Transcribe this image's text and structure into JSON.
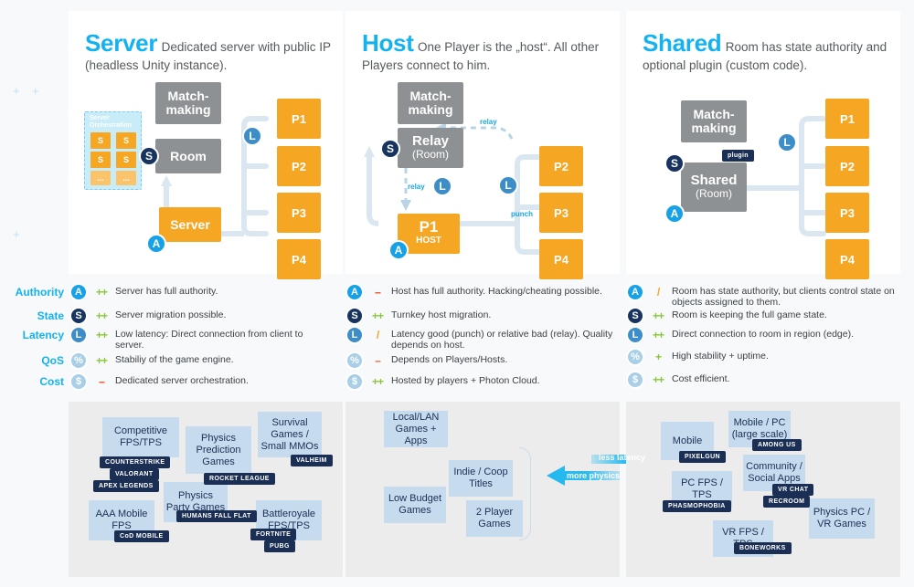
{
  "decor": {
    "plus_marks": [
      "+",
      "+",
      "+"
    ]
  },
  "panels": [
    {
      "id": "server",
      "title": "Server",
      "subtitle": "Dedicated server with public IP (headless Unity instance).",
      "nodes": {
        "matchmaking": "Match-\nmaking",
        "matchmaking_l1": "Match-",
        "matchmaking_l2": "making",
        "room": "Room",
        "server": "Server",
        "players": [
          "P1",
          "P2",
          "P3",
          "P4"
        ]
      },
      "orchestration": {
        "title_l1": "Server",
        "title_l2": "Orchestration",
        "tiles": [
          "S",
          "S",
          "S",
          "S",
          "...",
          "..."
        ]
      },
      "badges": {
        "state": "S",
        "latency": "L",
        "authority": "A"
      }
    },
    {
      "id": "host",
      "title": "Host",
      "subtitle": "One Player is the „host“. All other Players connect to him.",
      "nodes": {
        "matchmaking_l1": "Match-",
        "matchmaking_l2": "making",
        "relay_l1": "Relay",
        "relay_l2": "(Room)",
        "host_l1": "P1",
        "host_l2": "HOST",
        "players": [
          "P2",
          "P3",
          "P4"
        ]
      },
      "edge_labels": {
        "relay_top": "relay",
        "relay_left": "relay",
        "punch": "punch"
      },
      "badges": {
        "state": "S",
        "latency_left": "L",
        "latency_right": "L",
        "authority": "A"
      }
    },
    {
      "id": "shared",
      "title": "Shared",
      "subtitle": "Room has state authority and optional plugin (custom code).",
      "nodes": {
        "matchmaking_l1": "Match-",
        "matchmaking_l2": "making",
        "shared_l1": "Shared",
        "shared_l2": "(Room)",
        "players": [
          "P1",
          "P2",
          "P3",
          "P4"
        ]
      },
      "plugin_label": "plugin",
      "badges": {
        "state": "S",
        "latency": "L",
        "authority": "A"
      }
    }
  ],
  "criteria": {
    "categories": [
      "Authority",
      "State",
      "Latency",
      "QoS",
      "Cost"
    ],
    "icons": [
      "A",
      "S",
      "L",
      "%",
      "$"
    ],
    "columns": [
      {
        "id": "server",
        "rows": [
          {
            "rating": "++",
            "rating_kind": "pp",
            "text": "Server has full authority."
          },
          {
            "rating": "++",
            "rating_kind": "pp",
            "text": "Server migration possible."
          },
          {
            "rating": "++",
            "rating_kind": "pp",
            "text": "Low latency: Direct connection from client to server."
          },
          {
            "rating": "++",
            "rating_kind": "pp",
            "text": "Stabiliy of the game engine."
          },
          {
            "rating": "--",
            "rating_kind": "mm",
            "text": "Dedicated server orchestration."
          }
        ]
      },
      {
        "id": "host",
        "rows": [
          {
            "rating": "--",
            "rating_kind": "mm",
            "text": "Host has full authority. Hacking/cheating possible."
          },
          {
            "rating": "++",
            "rating_kind": "pp",
            "text": "Turnkey host migration."
          },
          {
            "rating": "/",
            "rating_kind": "sl",
            "text": "Latency good (punch) or relative bad (relay). Quality depends on host."
          },
          {
            "rating": "–",
            "rating_kind": "m",
            "text": "Depends on Players/Hosts."
          },
          {
            "rating": "++",
            "rating_kind": "pp",
            "text": "Hosted by players + Photon Cloud."
          }
        ]
      },
      {
        "id": "shared",
        "rows": [
          {
            "rating": "/",
            "rating_kind": "sl",
            "text": "Room has state authority, but clients control state on objects assigned to them."
          },
          {
            "rating": "++",
            "rating_kind": "pp",
            "text": "Room is keeping the full game state."
          },
          {
            "rating": "++",
            "rating_kind": "pp",
            "text": "Direct connection to room in region (edge)."
          },
          {
            "rating": "+",
            "rating_kind": "p",
            "text": "High stability + uptime."
          },
          {
            "rating": "++",
            "rating_kind": "pp",
            "text": "Cost efficient."
          }
        ]
      }
    ]
  },
  "usecases": {
    "server": [
      {
        "label": "Competitive FPS/TPS",
        "tags": [
          "COUNTERSTRIKE",
          "VALORANT",
          "APEX LEGENDS"
        ]
      },
      {
        "label": "Physics Prediction Games",
        "tags": [
          "ROCKET LEAGUE"
        ]
      },
      {
        "label": "Survival Games / Small MMOs",
        "tags": [
          "VALHEIM"
        ]
      },
      {
        "label": "Physics Party Games",
        "tags": [
          "HUMANS FALL FLAT"
        ]
      },
      {
        "label": "AAA Mobile FPS",
        "tags": [
          "CoD MOBILE"
        ]
      },
      {
        "label": "Battleroyale FPS/TPS",
        "tags": [
          "FORTNITE",
          "PUBG"
        ]
      }
    ],
    "host": [
      {
        "label": "Local/LAN Games + Apps",
        "tags": []
      },
      {
        "label": "Indie / Coop Titles",
        "tags": []
      },
      {
        "label": "Low Budget Games",
        "tags": []
      },
      {
        "label": "2 Player Games",
        "tags": []
      }
    ],
    "shared": [
      {
        "label": "Mobile",
        "tags": [
          "PIXELGUN"
        ]
      },
      {
        "label": "Mobile / PC (large scale)",
        "tags": [
          "AMONG US"
        ]
      },
      {
        "label": "Community / Social Apps",
        "tags": [
          "VR CHAT",
          "RECROOM"
        ]
      },
      {
        "label": "PC FPS / TPS",
        "tags": [
          "PHASMOPHOBIA"
        ]
      },
      {
        "label": "VR FPS / TPS",
        "tags": [
          "BONEWORKS"
        ]
      },
      {
        "label": "Physics PC / VR Games",
        "tags": []
      }
    ],
    "axis_arrow": {
      "right_label": "less latency",
      "left_label": "more physics"
    }
  },
  "colors": {
    "accent": "#14b2ef",
    "orange": "#f5a623",
    "gray_node": "#8e9193",
    "navy": "#1b2f55",
    "good": "#8cc63e",
    "bad": "#f05a28",
    "neutral": "#f5a623",
    "pale_blue": "#c6dcee"
  }
}
